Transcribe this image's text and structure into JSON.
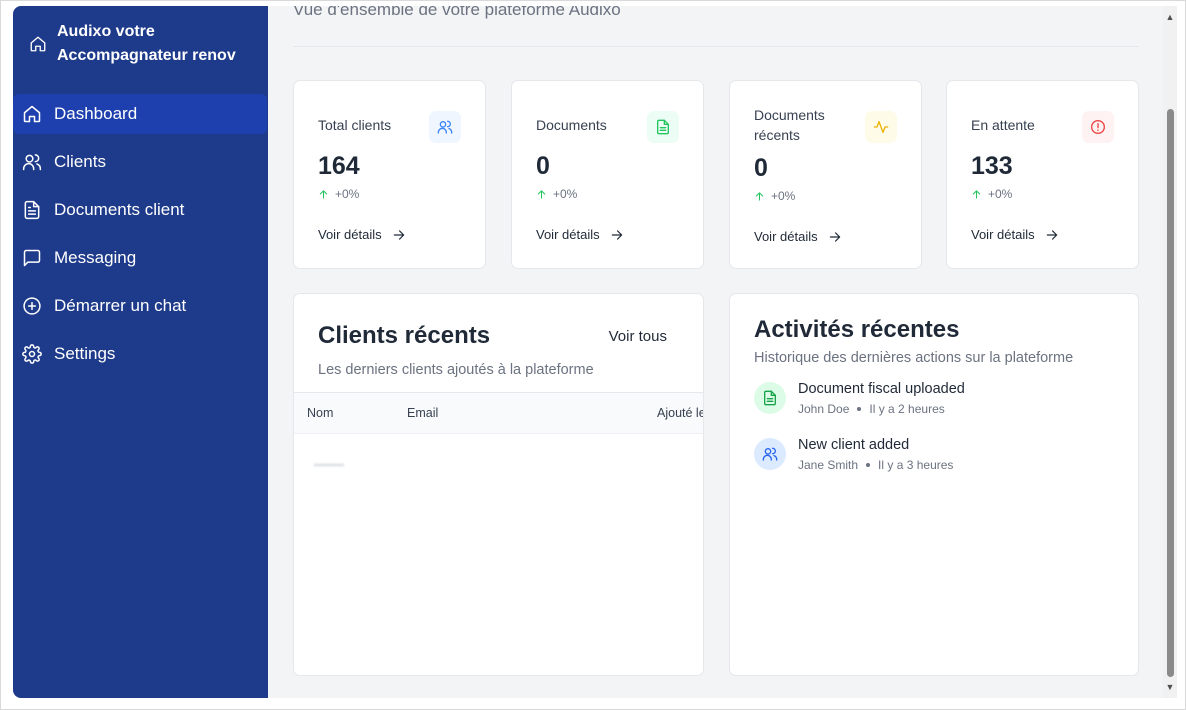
{
  "sidebar": {
    "brand": "Audixo votre Accompagnateur renov",
    "items": [
      {
        "label": "Dashboard",
        "icon": "home-icon",
        "active": true
      },
      {
        "label": "Clients",
        "icon": "users-icon"
      },
      {
        "label": "Documents client",
        "icon": "file-text-icon"
      },
      {
        "label": "Messaging",
        "icon": "message-square-icon"
      },
      {
        "label": "Démarrer un chat",
        "icon": "plus-circle-icon"
      },
      {
        "label": "Settings",
        "icon": "gear-icon"
      }
    ]
  },
  "main": {
    "subtitle": "Vue d'ensemble de votre plateforme Audixo",
    "stats": [
      {
        "title": "Total clients",
        "value": "164",
        "trend": "+0%",
        "link": "Voir détails",
        "icon": "users-icon",
        "accent": "#3b82f6",
        "bg": "#eff6ff"
      },
      {
        "title": "Documents",
        "value": "0",
        "trend": "+0%",
        "link": "Voir détails",
        "icon": "file-text-icon",
        "accent": "#22c55e",
        "bg": "#ecfdf5"
      },
      {
        "title": "Documents récents",
        "value": "0",
        "trend": "+0%",
        "link": "Voir détails",
        "icon": "activity-icon",
        "accent": "#eab308",
        "bg": "#fefce8"
      },
      {
        "title": "En attente",
        "value": "133",
        "trend": "+0%",
        "link": "Voir détails",
        "icon": "alert-circle-icon",
        "accent": "#ef4444",
        "bg": "#fef2f2"
      }
    ],
    "clients_panel": {
      "title": "Clients récents",
      "view_all": "Voir tous",
      "description": "Les derniers clients ajoutés à la plateforme",
      "columns": [
        "Nom",
        "Email",
        "Ajouté le"
      ]
    },
    "activity_panel": {
      "title": "Activités récentes",
      "description": "Historique des dernières actions sur la plateforme",
      "items": [
        {
          "title": "Document fiscal uploaded",
          "user": "John Doe",
          "time": "Il y a 2 heures",
          "icon": "file-text-icon",
          "accent": "#16a34a",
          "bg": "#dcfce7"
        },
        {
          "title": "New client added",
          "user": "Jane Smith",
          "time": "Il y a 3 heures",
          "icon": "users-icon",
          "accent": "#2563eb",
          "bg": "#dbeafe"
        }
      ]
    }
  }
}
